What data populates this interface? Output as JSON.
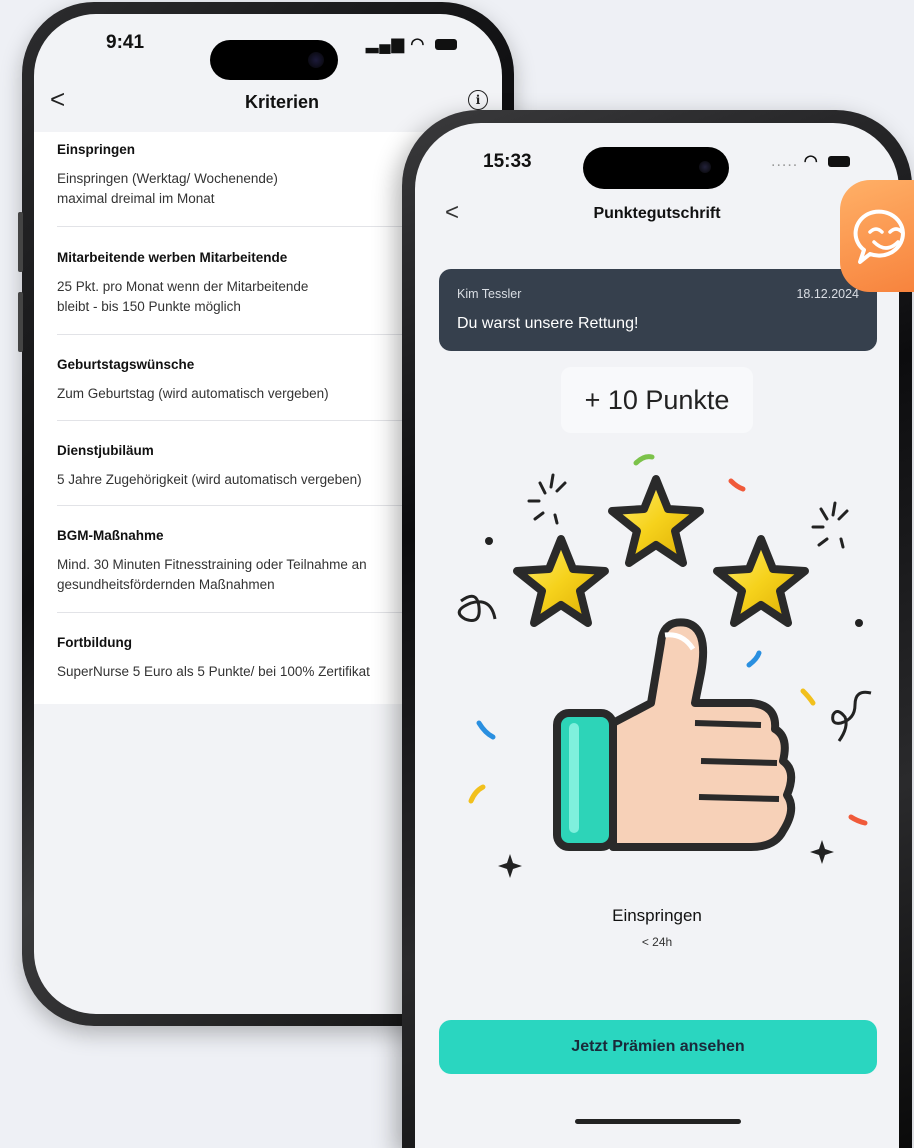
{
  "back_phone": {
    "status": {
      "time": "9:41"
    },
    "nav": {
      "title": "Kriterien",
      "back": "<",
      "info": "i"
    },
    "criteria": [
      {
        "title": "Einspringen",
        "lines": [
          "Einspringen (Werktag/ Wochenende)",
          "maximal dreimal im Monat"
        ]
      },
      {
        "title": "Mitarbeitende werben Mitarbeitende",
        "lines": [
          "25 Pkt. pro Monat wenn der Mitarbeitende",
          "bleibt - bis 150 Punkte möglich"
        ]
      },
      {
        "title": "Geburtstagswünsche",
        "lines": [
          "Zum Geburtstag (wird automatisch vergeben)"
        ]
      },
      {
        "title": "Dienstjubiläum",
        "lines": [
          "5 Jahre Zugehörigkeit (wird automatisch vergeben)"
        ]
      },
      {
        "title": "BGM-Maßnahme",
        "lines": [
          "Mind. 30 Minuten Fitnesstraining oder Teilnahme an",
          "gesundheitsfördernden Maßnahmen"
        ]
      },
      {
        "title": "Fortbildung",
        "lines": [
          "SuperNurse 5 Euro als 5 Punkte/ bei 100% Zertifikat"
        ]
      }
    ]
  },
  "front_phone": {
    "status": {
      "time": "15:33",
      "dots": "....."
    },
    "nav": {
      "title": "Punktegutschrift",
      "back": "<"
    },
    "message": {
      "sender": "Kim Tessler",
      "date": "18.12.2024",
      "text": "Du warst unsere Rettung!"
    },
    "points": "+ 10 Punkte",
    "category": "Einspringen",
    "category_sub": "< 24h",
    "cta": "Jetzt Prämien ansehen"
  },
  "icons": {
    "chat_bubble": "smiley-chat-icon",
    "illustration": "thumbs-up-stars-icon"
  },
  "colors": {
    "accent": "#2ad6c0",
    "card": "#36404d",
    "bubble": "#f7813b",
    "star": "#f6d21c"
  }
}
